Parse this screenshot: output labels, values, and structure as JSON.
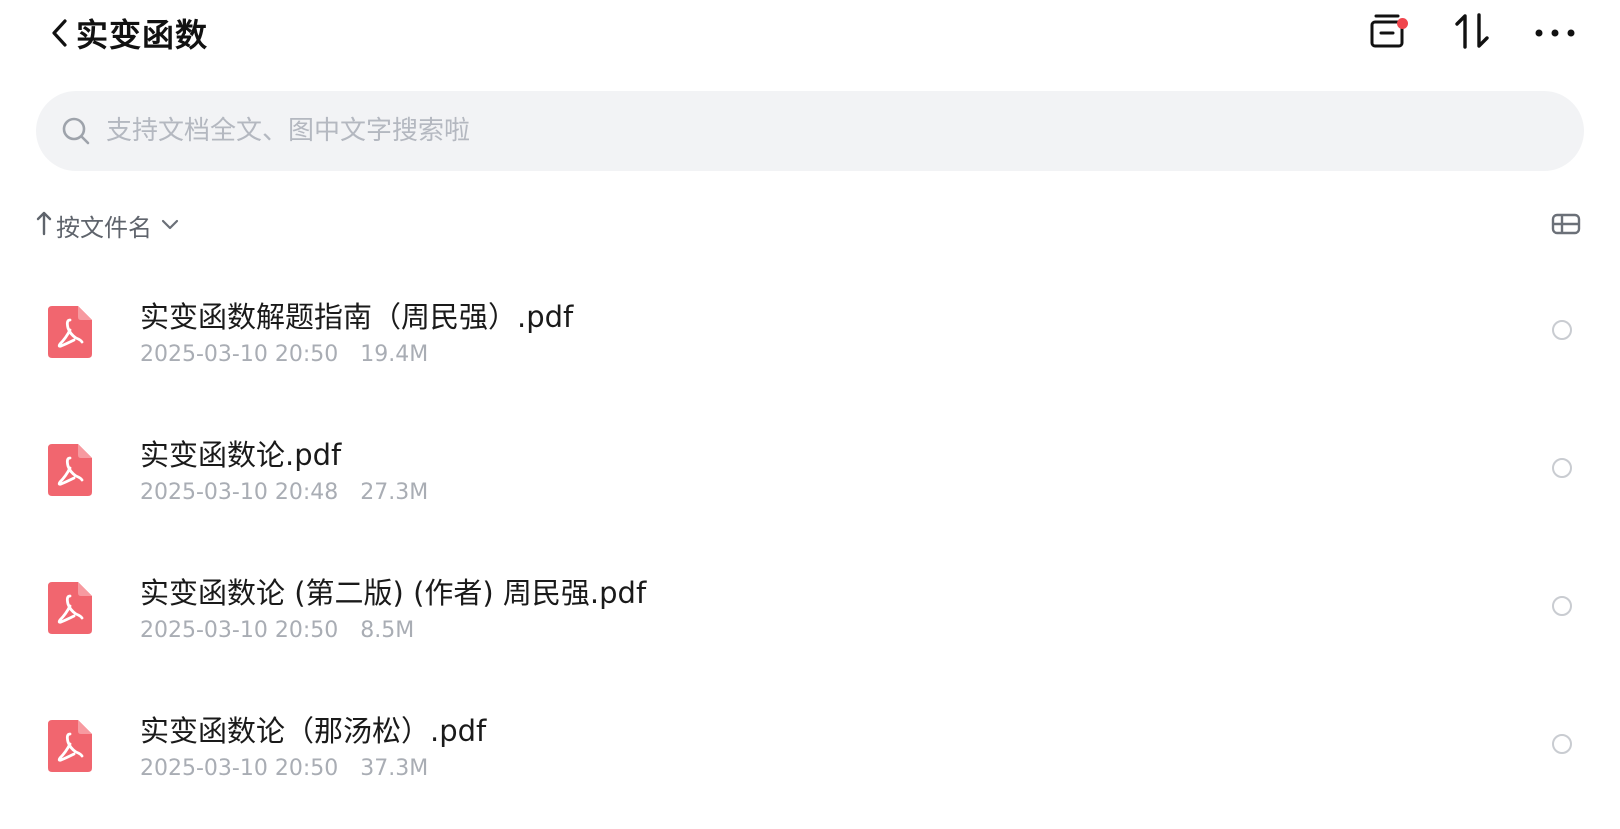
{
  "header": {
    "title": "实变函数",
    "icons": {
      "back": "chevron-left-icon",
      "archive": "archive-box-icon",
      "sort": "sort-arrows-icon",
      "more": "more-horizontal-icon"
    }
  },
  "search": {
    "placeholder": "支持文档全文、图中文字搜索啦"
  },
  "sort": {
    "label": "按文件名",
    "direction": "ascending"
  },
  "colors": {
    "accent_red": "#f0464d",
    "pdf_icon": "#f1666f",
    "meta_text": "#a9adb4",
    "search_bg": "#f2f3f5"
  },
  "files": [
    {
      "name": "实变函数解题指南（周民强）.pdf",
      "date": "2025-03-10 20:50",
      "size": "19.4M",
      "type": "pdf-icon"
    },
    {
      "name": "实变函数论.pdf",
      "date": "2025-03-10 20:48",
      "size": "27.3M",
      "type": "pdf-icon"
    },
    {
      "name": "实变函数论 (第二版) (作者) 周民强.pdf",
      "date": "2025-03-10 20:50",
      "size": "8.5M",
      "type": "pdf-icon"
    },
    {
      "name": "实变函数论（那汤松）.pdf",
      "date": "2025-03-10 20:50",
      "size": "37.3M",
      "type": "pdf-icon"
    }
  ]
}
